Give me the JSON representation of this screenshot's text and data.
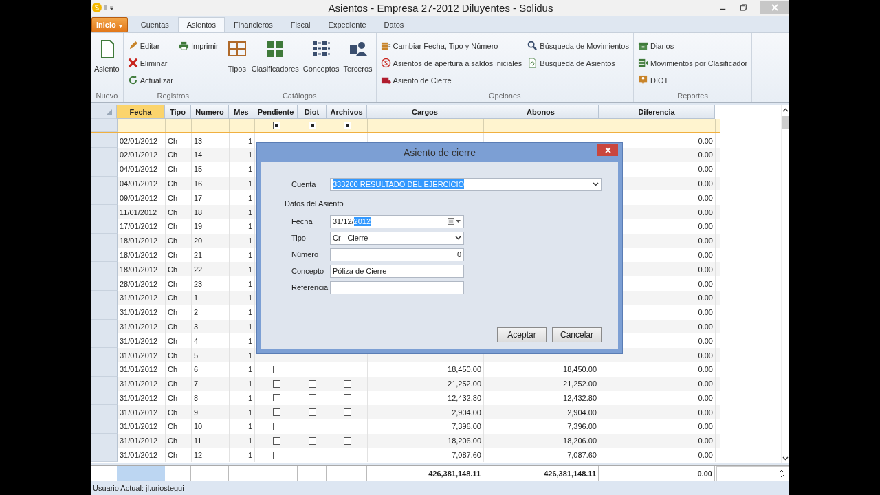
{
  "window": {
    "title": "Asientos - Empresa 27-2012 Diluyentes - Solidus"
  },
  "app_button": {
    "label": "Inicio"
  },
  "tabs": [
    {
      "label": "Cuentas",
      "selected": false
    },
    {
      "label": "Asientos",
      "selected": true
    },
    {
      "label": "Financieros",
      "selected": false
    },
    {
      "label": "Fiscal",
      "selected": false
    },
    {
      "label": "Expediente",
      "selected": false
    },
    {
      "label": "Datos",
      "selected": false
    }
  ],
  "ribbon": {
    "groups": [
      {
        "title": "Nuevo",
        "kind": "large",
        "items": [
          "Asiento"
        ]
      },
      {
        "title": "Registros",
        "kind": "small",
        "columns": [
          [
            "Editar",
            "Eliminar",
            "Actualizar"
          ],
          [
            "Imprimir"
          ]
        ]
      },
      {
        "title": "Catálogos",
        "kind": "large",
        "items": [
          "Tipos",
          "Clasificadores",
          "Conceptos",
          "Terceros"
        ]
      },
      {
        "title": "Opciones",
        "kind": "small",
        "columns": [
          [
            "Cambiar Fecha, Tipo y Número",
            "Asientos de apertura a saldos iniciales",
            "Asiento de Cierre"
          ],
          [
            "Búsqueda de Movimientos",
            "Búsqueda de Asientos"
          ]
        ]
      },
      {
        "title": "Reportes",
        "kind": "small",
        "columns": [
          [
            "Diarios",
            "Movimientos por Clasificador",
            "DIOT"
          ]
        ]
      }
    ]
  },
  "table": {
    "columns": [
      "Fecha",
      "Tipo",
      "Numero",
      "Mes",
      "Pendiente",
      "Diot",
      "Archivos",
      "Cargos",
      "Abonos",
      "Diferencia"
    ],
    "filter": {
      "pendiente": {
        "indeterminate": true
      },
      "diot": {
        "indeterminate": true
      },
      "archivos": {
        "indeterminate": true
      }
    },
    "rows": [
      {
        "fecha": "02/01/2012",
        "tipo": "Ch",
        "numero": "13",
        "mes": "1",
        "diferencia": "0.00"
      },
      {
        "fecha": "02/01/2012",
        "tipo": "Ch",
        "numero": "14",
        "mes": "1",
        "diferencia": "0.00"
      },
      {
        "fecha": "04/01/2012",
        "tipo": "Ch",
        "numero": "15",
        "mes": "1",
        "diferencia": "0.00"
      },
      {
        "fecha": "04/01/2012",
        "tipo": "Ch",
        "numero": "16",
        "mes": "1",
        "diferencia": "0.00"
      },
      {
        "fecha": "09/01/2012",
        "tipo": "Ch",
        "numero": "17",
        "mes": "1",
        "diferencia": "0.00"
      },
      {
        "fecha": "11/01/2012",
        "tipo": "Ch",
        "numero": "18",
        "mes": "1",
        "diferencia": "0.00"
      },
      {
        "fecha": "17/01/2012",
        "tipo": "Ch",
        "numero": "19",
        "mes": "1",
        "diferencia": "0.00"
      },
      {
        "fecha": "18/01/2012",
        "tipo": "Ch",
        "numero": "20",
        "mes": "1",
        "diferencia": "0.00"
      },
      {
        "fecha": "18/01/2012",
        "tipo": "Ch",
        "numero": "21",
        "mes": "1",
        "diferencia": "0.00"
      },
      {
        "fecha": "18/01/2012",
        "tipo": "Ch",
        "numero": "22",
        "mes": "1",
        "diferencia": "0.00"
      },
      {
        "fecha": "28/01/2012",
        "tipo": "Ch",
        "numero": "23",
        "mes": "1",
        "diferencia": "0.00"
      },
      {
        "fecha": "31/01/2012",
        "tipo": "Ch",
        "numero": "1",
        "mes": "1",
        "diferencia": "0.00"
      },
      {
        "fecha": "31/01/2012",
        "tipo": "Ch",
        "numero": "2",
        "mes": "1",
        "diferencia": "0.00"
      },
      {
        "fecha": "31/01/2012",
        "tipo": "Ch",
        "numero": "3",
        "mes": "1",
        "diferencia": "0.00"
      },
      {
        "fecha": "31/01/2012",
        "tipo": "Ch",
        "numero": "4",
        "mes": "1",
        "diferencia": "0.00"
      },
      {
        "fecha": "31/01/2012",
        "tipo": "Ch",
        "numero": "5",
        "mes": "1",
        "diferencia": "0.00"
      },
      {
        "fecha": "31/01/2012",
        "tipo": "Ch",
        "numero": "6",
        "mes": "1",
        "pendiente": false,
        "diot": false,
        "archivos": false,
        "cargos": "18,450.00",
        "abonos": "18,450.00",
        "diferencia": "0.00"
      },
      {
        "fecha": "31/01/2012",
        "tipo": "Ch",
        "numero": "7",
        "mes": "1",
        "pendiente": false,
        "diot": false,
        "archivos": false,
        "cargos": "21,252.00",
        "abonos": "21,252.00",
        "diferencia": "0.00"
      },
      {
        "fecha": "31/01/2012",
        "tipo": "Ch",
        "numero": "8",
        "mes": "1",
        "pendiente": false,
        "diot": false,
        "archivos": false,
        "cargos": "12,432.80",
        "abonos": "12,432.80",
        "diferencia": "0.00"
      },
      {
        "fecha": "31/01/2012",
        "tipo": "Ch",
        "numero": "9",
        "mes": "1",
        "pendiente": false,
        "diot": false,
        "archivos": false,
        "cargos": "2,904.00",
        "abonos": "2,904.00",
        "diferencia": "0.00"
      },
      {
        "fecha": "31/01/2012",
        "tipo": "Ch",
        "numero": "10",
        "mes": "1",
        "pendiente": false,
        "diot": false,
        "archivos": false,
        "cargos": "7,396.00",
        "abonos": "7,396.00",
        "diferencia": "0.00"
      },
      {
        "fecha": "31/01/2012",
        "tipo": "Ch",
        "numero": "11",
        "mes": "1",
        "pendiente": false,
        "diot": false,
        "archivos": false,
        "cargos": "18,206.00",
        "abonos": "18,206.00",
        "diferencia": "0.00"
      },
      {
        "fecha": "31/01/2012",
        "tipo": "Ch",
        "numero": "12",
        "mes": "1",
        "pendiente": false,
        "diot": false,
        "archivos": false,
        "cargos": "7,087.60",
        "abonos": "7,087.60",
        "diferencia": "0.00"
      }
    ],
    "totals": {
      "cargos": "426,381,148.11",
      "abonos": "426,381,148.11",
      "diferencia": "0.00"
    }
  },
  "dialog": {
    "title": "Asiento de cierre",
    "cuenta": {
      "label": "Cuenta",
      "kind": "combo",
      "selected_text": "333200 RESULTADO DEL EJERCICIO"
    },
    "section": "Datos del Asiento",
    "fields": [
      {
        "label": "Fecha",
        "kind": "date",
        "value": "31/12/",
        "selected_text": "2012"
      },
      {
        "label": "Tipo",
        "kind": "combo",
        "value": "Cr - Cierre"
      },
      {
        "label": "Número",
        "kind": "number",
        "value": "0"
      },
      {
        "label": "Concepto",
        "kind": "text",
        "value": "Póliza de Cierre"
      },
      {
        "label": "Referencia",
        "kind": "text"
      }
    ],
    "buttons": [
      "Aceptar",
      "Cancelar"
    ]
  },
  "status_bar": {
    "user": "Usuario Actual: jl.uriostegui"
  }
}
